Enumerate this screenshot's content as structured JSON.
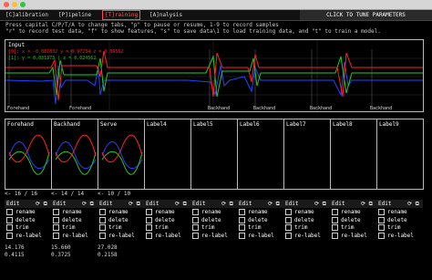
{
  "window": {
    "close_color": "#ff5f57",
    "min_color": "#ffbd2e",
    "max_color": "#28c940"
  },
  "tabs": [
    {
      "label": "[C]alibration"
    },
    {
      "label": "[P]ipeline"
    },
    {
      "label": "[T]raining"
    },
    {
      "label": "[A]nalysis"
    }
  ],
  "active_tab": "[T]raining",
  "tune_button": "CLICK TO TUNE PARAMETERS",
  "instructions": [
    "Press capital C/P/T/A to change tabs, \"p\" to pause or resume, 1-9 to record samples",
    "\"r\" to record test data, \"f\" to show features, \"s\" to save data\\1 to load training data, and \"t\" to train a model."
  ],
  "plot": {
    "title": "Input",
    "legend": [
      {
        "text": "[0]: x = -0.087832 y = 0.97234 z = 0.09562",
        "color": "#ff2020"
      },
      {
        "text": "[1]: y = 0.031973 | z = 0.024562",
        "color": "#22cc22"
      }
    ],
    "markers": [
      "Forehand",
      "Forehand",
      "Backhand",
      "Backhand",
      "Backhand",
      "Backhand"
    ]
  },
  "classes": [
    {
      "label": "Forehand",
      "count": "<- 16 / 16",
      "edit": "Edit",
      "icon": "⟳ ⧉"
    },
    {
      "label": "Backhand",
      "count": "<- 14 / 14",
      "edit": "Edit",
      "icon": "⟳ ⧉"
    },
    {
      "label": "Serve",
      "count": "<- 10 / 10",
      "edit": "Edit",
      "icon": "⟳ ⧉"
    },
    {
      "label": "Label4",
      "count": "",
      "edit": "Edit",
      "icon": "⟳ ⧉"
    },
    {
      "label": "Label5",
      "count": "",
      "edit": "Edit",
      "icon": "⟳ ⧉"
    },
    {
      "label": "Label6",
      "count": "",
      "edit": "Edit",
      "icon": "⟳ ⧉"
    },
    {
      "label": "Label7",
      "count": "",
      "edit": "Edit",
      "icon": "⟳ ⧉"
    },
    {
      "label": "Label8",
      "count": "",
      "edit": "Edit",
      "icon": "⟳ ⧉"
    },
    {
      "label": "Label9",
      "count": "",
      "edit": "Edit",
      "icon": "⟳ ⧉"
    }
  ],
  "options": [
    "rename",
    "delete",
    "trim",
    "re-label"
  ],
  "stats": [
    {
      "top": "14.176",
      "bottom": "0.4115"
    },
    {
      "top": "15.660",
      "bottom": "0.3725"
    },
    {
      "top": "27.028",
      "bottom": "0.2158"
    }
  ]
}
